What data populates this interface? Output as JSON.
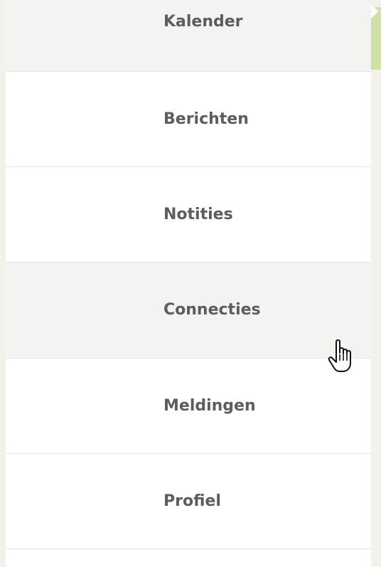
{
  "menu": {
    "items": [
      {
        "label": "Kalender",
        "state": "active"
      },
      {
        "label": "Berichten",
        "state": "normal"
      },
      {
        "label": "Notities",
        "state": "normal"
      },
      {
        "label": "Connecties",
        "state": "hover"
      },
      {
        "label": "Meldingen",
        "state": "normal"
      },
      {
        "label": "Profiel",
        "state": "normal"
      },
      {
        "label": "",
        "state": "normal"
      }
    ]
  },
  "colors": {
    "text": "#5d5d5d",
    "row_highlight": "#f3f3f1",
    "divider": "#e6e5e0",
    "rail": "#f2f1ec",
    "accent": "#cfe1a6"
  },
  "cursor": {
    "icon": "hand-pointer-icon"
  }
}
